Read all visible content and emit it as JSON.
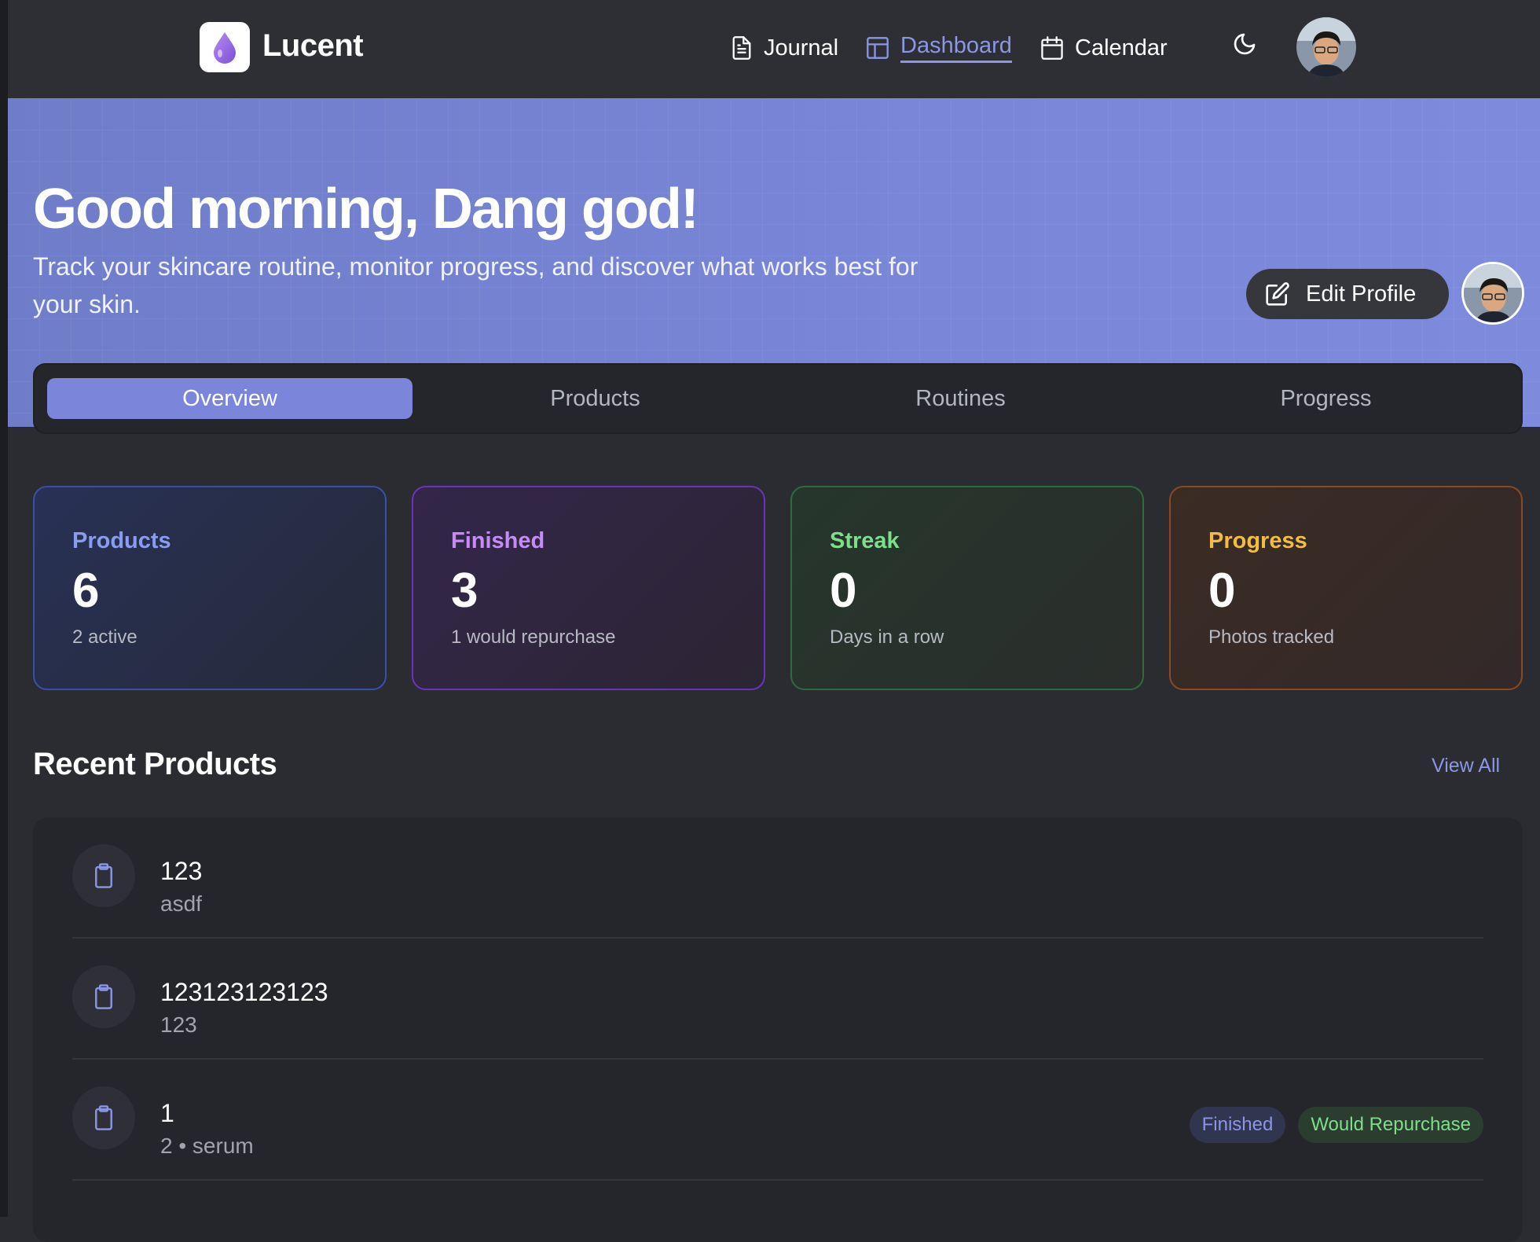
{
  "app": {
    "name": "Lucent"
  },
  "nav": {
    "journal": "Journal",
    "dashboard": "Dashboard",
    "calendar": "Calendar"
  },
  "hero": {
    "greeting": "Good morning, Dang god!",
    "subtitle": "Track your skincare routine, monitor progress, and discover what works best for your skin.",
    "edit_profile": "Edit Profile"
  },
  "tabs": [
    "Overview",
    "Products",
    "Routines",
    "Progress"
  ],
  "stats": [
    {
      "label": "Products",
      "value": "6",
      "sub": "2 active",
      "color": "#8a9cf0"
    },
    {
      "label": "Finished",
      "value": "3",
      "sub": "1 would repurchase",
      "color": "#c68cf5"
    },
    {
      "label": "Streak",
      "value": "0",
      "sub": "Days in a row",
      "color": "#7ede8c"
    },
    {
      "label": "Progress",
      "value": "0",
      "sub": "Photos tracked",
      "color": "#f2bd45"
    }
  ],
  "recent": {
    "title": "Recent Products",
    "view_all": "View All",
    "items": [
      {
        "name": "123",
        "sub": "asdf"
      },
      {
        "name": "123123123123",
        "sub": "123"
      },
      {
        "name": "1",
        "sub": "2 • serum",
        "badges": [
          "Finished",
          "Would Repurchase"
        ]
      }
    ]
  },
  "colors": {
    "accent": "#7b86db",
    "background": "#2b2c31"
  }
}
